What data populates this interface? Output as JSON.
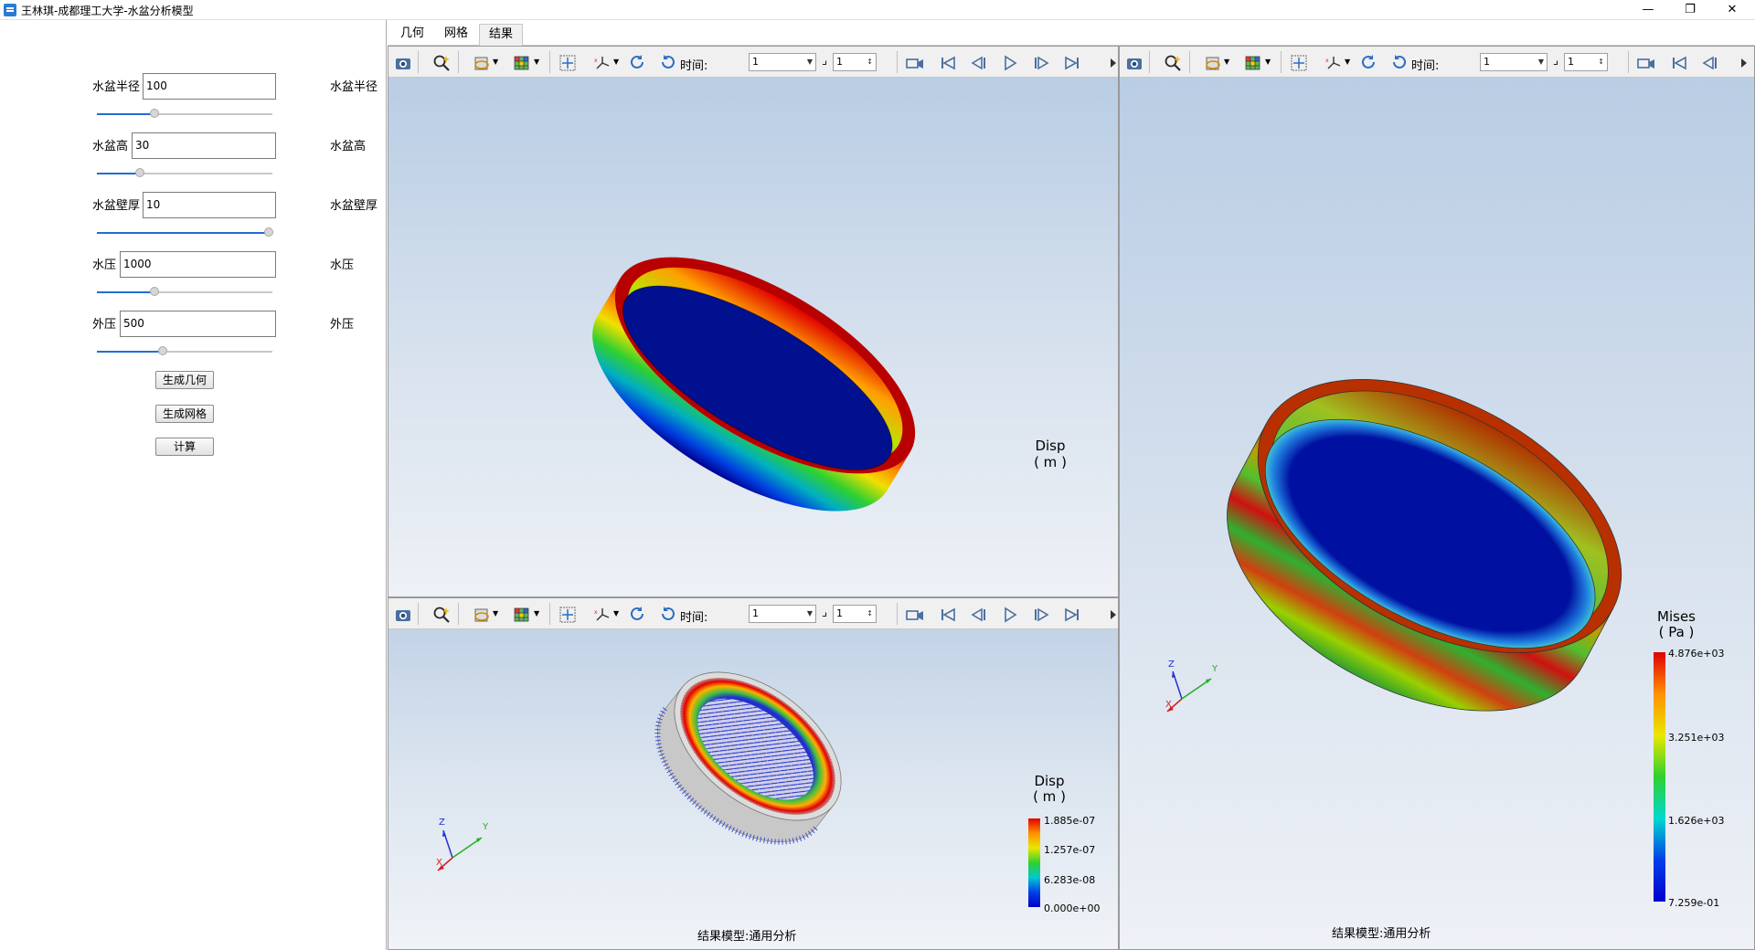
{
  "window": {
    "title": "王林琪-成都理工大学-水盆分析模型",
    "controls": [
      "—",
      "❐",
      "✕"
    ]
  },
  "params": [
    {
      "label": "水盆半径",
      "value": "100",
      "unit": "水盆半径",
      "slider": 0.27
    },
    {
      "label": "水盆高",
      "value": "30",
      "unit": "水盆高",
      "slider": 0.2
    },
    {
      "label": "水盆壁厚",
      "value": "10",
      "unit": "水盆壁厚",
      "slider": 1.0
    },
    {
      "label": "水压",
      "value": "1000",
      "unit": "水压",
      "slider": 0.27
    },
    {
      "label": "外压",
      "value": "500",
      "unit": "外压",
      "slider": 0.31
    }
  ],
  "buttons": {
    "gen_geometry": "生成几何",
    "gen_mesh": "生成网格",
    "compute": "计算"
  },
  "tabs": [
    "几何",
    "网格",
    "结果"
  ],
  "toolbar": {
    "time_label": "时间:",
    "time_value": "1",
    "frame_value": "1",
    "frame_mark": "⌟"
  },
  "viewports": {
    "top_left": {
      "legend_title": "Disp",
      "legend_unit": "( m )"
    },
    "bottom_left": {
      "legend_title": "Disp",
      "legend_unit": "( m )",
      "legend_values": [
        "1.885e-07",
        "1.257e-07",
        "6.283e-08",
        "0.000e+00"
      ],
      "caption": "结果模型:通用分析"
    },
    "right": {
      "legend_title": "Mises",
      "legend_unit": "( Pa )",
      "legend_values": [
        "4.876e+03",
        "3.251e+03",
        "1.626e+03",
        "7.259e-01"
      ],
      "caption": "结果模型:通用分析"
    }
  },
  "axes": {
    "x": "X",
    "y": "Y",
    "z": "Z"
  },
  "colors": {
    "accent": "#1f6fd1",
    "ramp_top": "#e00000",
    "ramp_bottom": "#0000dd"
  }
}
